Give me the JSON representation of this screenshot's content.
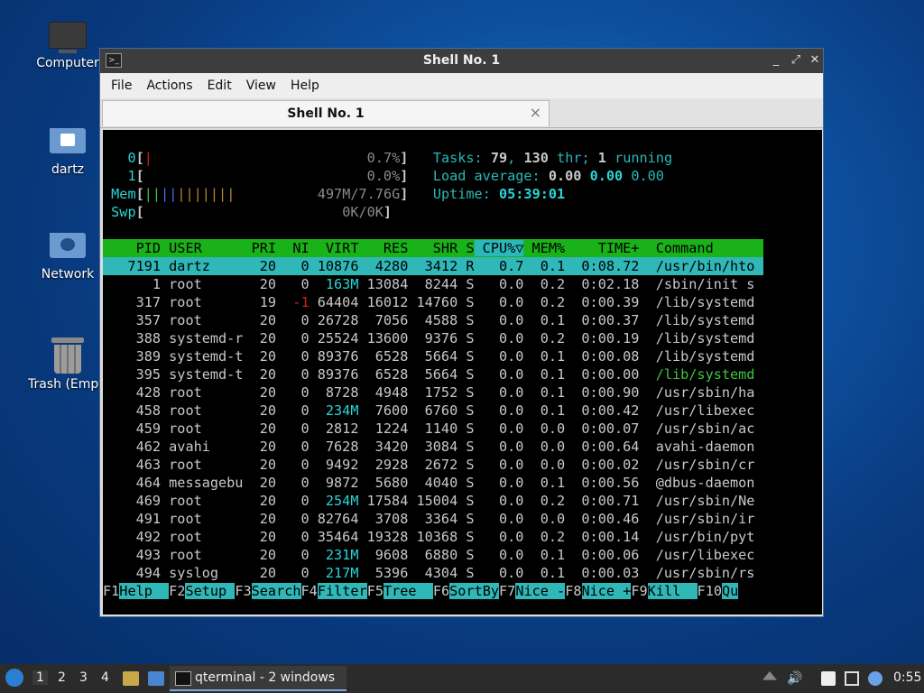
{
  "desktop": {
    "icons": [
      {
        "label": "Computer"
      },
      {
        "label": "dartz"
      },
      {
        "label": "Network"
      },
      {
        "label": "Trash (Empty)"
      }
    ]
  },
  "window": {
    "title": "Shell No. 1",
    "menu": [
      "File",
      "Actions",
      "Edit",
      "View",
      "Help"
    ],
    "tab_label": "Shell No. 1",
    "tab_close": "×"
  },
  "htop": {
    "meters": {
      "cpu0_label": "0",
      "cpu0_value": "0.7%",
      "cpu1_label": "1",
      "cpu1_value": "0.0%",
      "mem_label": "Mem",
      "mem_value": "497M/7.76G",
      "swp_label": "Swp",
      "swp_value": "0K/0K",
      "tasks_label": "Tasks:",
      "tasks": "79",
      "threads": "130",
      "thr_label": "thr;",
      "running": "1",
      "running_label": "running",
      "load_label": "Load average:",
      "load1": "0.00",
      "load5": "0.00",
      "load15": "0.00",
      "uptime_label": "Uptime:",
      "uptime": "05:39:01"
    },
    "headers": [
      "PID",
      "USER",
      "PRI",
      "NI",
      "VIRT",
      "RES",
      "SHR",
      "S",
      "CPU%▽",
      "MEM%",
      "TIME+",
      "Command"
    ],
    "processes": [
      {
        "pid": "7191",
        "user": "dartz",
        "pri": "20",
        "ni": "0",
        "virt": "10876",
        "res": "4280",
        "shr": "3412",
        "s": "R",
        "cpu": "0.7",
        "mem": "0.1",
        "time": "0:08.72",
        "cmd": "/usr/bin/hto"
      },
      {
        "pid": "1",
        "user": "root",
        "pri": "20",
        "ni": "0",
        "virt": "163M",
        "res": "13084",
        "shr": "8244",
        "s": "S",
        "cpu": "0.0",
        "mem": "0.2",
        "time": "0:02.18",
        "cmd": "/sbin/init s"
      },
      {
        "pid": "317",
        "user": "root",
        "pri": "19",
        "ni": "-1",
        "virt": "64404",
        "res": "16012",
        "shr": "14760",
        "s": "S",
        "cpu": "0.0",
        "mem": "0.2",
        "time": "0:00.39",
        "cmd": "/lib/systemd"
      },
      {
        "pid": "357",
        "user": "root",
        "pri": "20",
        "ni": "0",
        "virt": "26728",
        "res": "7056",
        "shr": "4588",
        "s": "S",
        "cpu": "0.0",
        "mem": "0.1",
        "time": "0:00.37",
        "cmd": "/lib/systemd"
      },
      {
        "pid": "388",
        "user": "systemd-r",
        "pri": "20",
        "ni": "0",
        "virt": "25524",
        "res": "13600",
        "shr": "9376",
        "s": "S",
        "cpu": "0.0",
        "mem": "0.2",
        "time": "0:00.19",
        "cmd": "/lib/systemd"
      },
      {
        "pid": "389",
        "user": "systemd-t",
        "pri": "20",
        "ni": "0",
        "virt": "89376",
        "res": "6528",
        "shr": "5664",
        "s": "S",
        "cpu": "0.0",
        "mem": "0.1",
        "time": "0:00.08",
        "cmd": "/lib/systemd"
      },
      {
        "pid": "395",
        "user": "systemd-t",
        "pri": "20",
        "ni": "0",
        "virt": "89376",
        "res": "6528",
        "shr": "5664",
        "s": "S",
        "cpu": "0.0",
        "mem": "0.1",
        "time": "0:00.00",
        "cmd": "/lib/systemd"
      },
      {
        "pid": "428",
        "user": "root",
        "pri": "20",
        "ni": "0",
        "virt": "8728",
        "res": "4948",
        "shr": "1752",
        "s": "S",
        "cpu": "0.0",
        "mem": "0.1",
        "time": "0:00.90",
        "cmd": "/usr/sbin/ha"
      },
      {
        "pid": "458",
        "user": "root",
        "pri": "20",
        "ni": "0",
        "virt": "234M",
        "res": "7600",
        "shr": "6760",
        "s": "S",
        "cpu": "0.0",
        "mem": "0.1",
        "time": "0:00.42",
        "cmd": "/usr/libexec"
      },
      {
        "pid": "459",
        "user": "root",
        "pri": "20",
        "ni": "0",
        "virt": "2812",
        "res": "1224",
        "shr": "1140",
        "s": "S",
        "cpu": "0.0",
        "mem": "0.0",
        "time": "0:00.07",
        "cmd": "/usr/sbin/ac"
      },
      {
        "pid": "462",
        "user": "avahi",
        "pri": "20",
        "ni": "0",
        "virt": "7628",
        "res": "3420",
        "shr": "3084",
        "s": "S",
        "cpu": "0.0",
        "mem": "0.0",
        "time": "0:00.64",
        "cmd": "avahi-daemon"
      },
      {
        "pid": "463",
        "user": "root",
        "pri": "20",
        "ni": "0",
        "virt": "9492",
        "res": "2928",
        "shr": "2672",
        "s": "S",
        "cpu": "0.0",
        "mem": "0.0",
        "time": "0:00.02",
        "cmd": "/usr/sbin/cr"
      },
      {
        "pid": "464",
        "user": "messagebu",
        "pri": "20",
        "ni": "0",
        "virt": "9872",
        "res": "5680",
        "shr": "4040",
        "s": "S",
        "cpu": "0.0",
        "mem": "0.1",
        "time": "0:00.56",
        "cmd": "@dbus-daemon"
      },
      {
        "pid": "469",
        "user": "root",
        "pri": "20",
        "ni": "0",
        "virt": "254M",
        "res": "17584",
        "shr": "15004",
        "s": "S",
        "cpu": "0.0",
        "mem": "0.2",
        "time": "0:00.71",
        "cmd": "/usr/sbin/Ne"
      },
      {
        "pid": "491",
        "user": "root",
        "pri": "20",
        "ni": "0",
        "virt": "82764",
        "res": "3708",
        "shr": "3364",
        "s": "S",
        "cpu": "0.0",
        "mem": "0.0",
        "time": "0:00.46",
        "cmd": "/usr/sbin/ir"
      },
      {
        "pid": "492",
        "user": "root",
        "pri": "20",
        "ni": "0",
        "virt": "35464",
        "res": "19328",
        "shr": "10368",
        "s": "S",
        "cpu": "0.0",
        "mem": "0.2",
        "time": "0:00.14",
        "cmd": "/usr/bin/pyt"
      },
      {
        "pid": "493",
        "user": "root",
        "pri": "20",
        "ni": "0",
        "virt": "231M",
        "res": "9608",
        "shr": "6880",
        "s": "S",
        "cpu": "0.0",
        "mem": "0.1",
        "time": "0:00.06",
        "cmd": "/usr/libexec"
      },
      {
        "pid": "494",
        "user": "syslog",
        "pri": "20",
        "ni": "0",
        "virt": "217M",
        "res": "5396",
        "shr": "4304",
        "s": "S",
        "cpu": "0.0",
        "mem": "0.1",
        "time": "0:00.03",
        "cmd": "/usr/sbin/rs"
      }
    ],
    "fkeys": [
      {
        "key": "F1",
        "label": "Help  "
      },
      {
        "key": "F2",
        "label": "Setup "
      },
      {
        "key": "F3",
        "label": "Search"
      },
      {
        "key": "F4",
        "label": "Filter"
      },
      {
        "key": "F5",
        "label": "Tree  "
      },
      {
        "key": "F6",
        "label": "SortBy"
      },
      {
        "key": "F7",
        "label": "Nice -"
      },
      {
        "key": "F8",
        "label": "Nice +"
      },
      {
        "key": "F9",
        "label": "Kill  "
      },
      {
        "key": "F10",
        "label": "Qu"
      }
    ]
  },
  "taskbar": {
    "workspaces": [
      "1",
      "2",
      "3",
      "4"
    ],
    "task_label": "qterminal - 2 windows",
    "clock": "0:55"
  },
  "colors": {
    "selected_row": "#30b8b8",
    "header_row": "#19b219",
    "accent_cyan": "#29d5d5"
  }
}
